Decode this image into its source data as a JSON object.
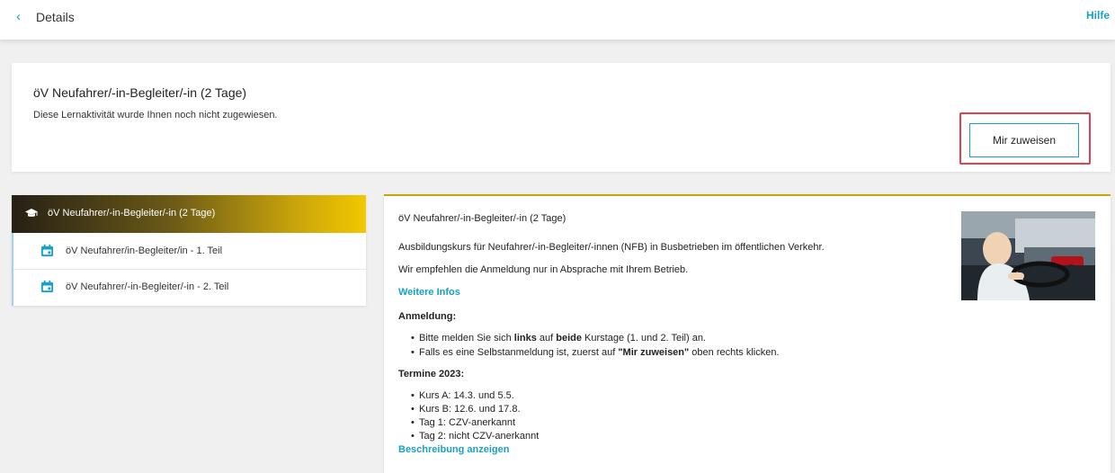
{
  "topbar": {
    "back_icon": "‹",
    "title": "Details",
    "help": "Hilfe"
  },
  "header": {
    "title": "öV Neufahrer/-in-Begleiter/-in (2 Tage)",
    "subtitle": "Diese Lernaktivität wurde Ihnen noch nicht zugewiesen.",
    "assign_button": "Mir zuweisen"
  },
  "sidebar": {
    "head": {
      "icon": "graduation-cap-icon",
      "label": "öV Neufahrer/-in-Begleiter/-in (2 Tage)"
    },
    "items": [
      {
        "icon": "calendar-icon",
        "label": "öV Neufahrer/in-Begleiter/in - 1. Teil"
      },
      {
        "icon": "calendar-icon",
        "label": "öV Neufahrer/-in-Begleiter/-in - 2. Teil"
      }
    ]
  },
  "main": {
    "title": "öV Neufahrer/-in-Begleiter/-in (2 Tage)",
    "p1": "Ausbildungskurs für Neufahrer/-in-Begleiter/-innen (NFB) in Busbetrieben im öffentlichen Verkehr.",
    "p2": "Wir empfehlen die Anmeldung nur in Absprache mit Ihrem Betrieb.",
    "more_link": "Weitere Infos",
    "anmeldung_heading": "Anmeldung:",
    "anmeldung_items": [
      {
        "a": "Bitte melden Sie sich ",
        "b": "links",
        "c": " auf ",
        "d": "beide",
        "e": " Kurstage (1. und 2. Teil) an."
      },
      {
        "a": "Falls es eine Selbstanmeldung ist, zuerst auf ",
        "b": "\"Mir zuweisen\"",
        "c": " oben rechts klicken."
      }
    ],
    "termine_heading": "Termine 2023:",
    "termine_items": [
      "Kurs A: 14.3. und 5.5.",
      "Kurs B: 12.6. und 17.8.",
      "Tag 1: CZV-anerkannt",
      "Tag 2: nicht CZV-anerkannt"
    ],
    "show_description": "Beschreibung anzeigen"
  },
  "colors": {
    "accent": "#1aa0c8",
    "highlight": "#e0434b",
    "gold": "#c9a40b"
  }
}
